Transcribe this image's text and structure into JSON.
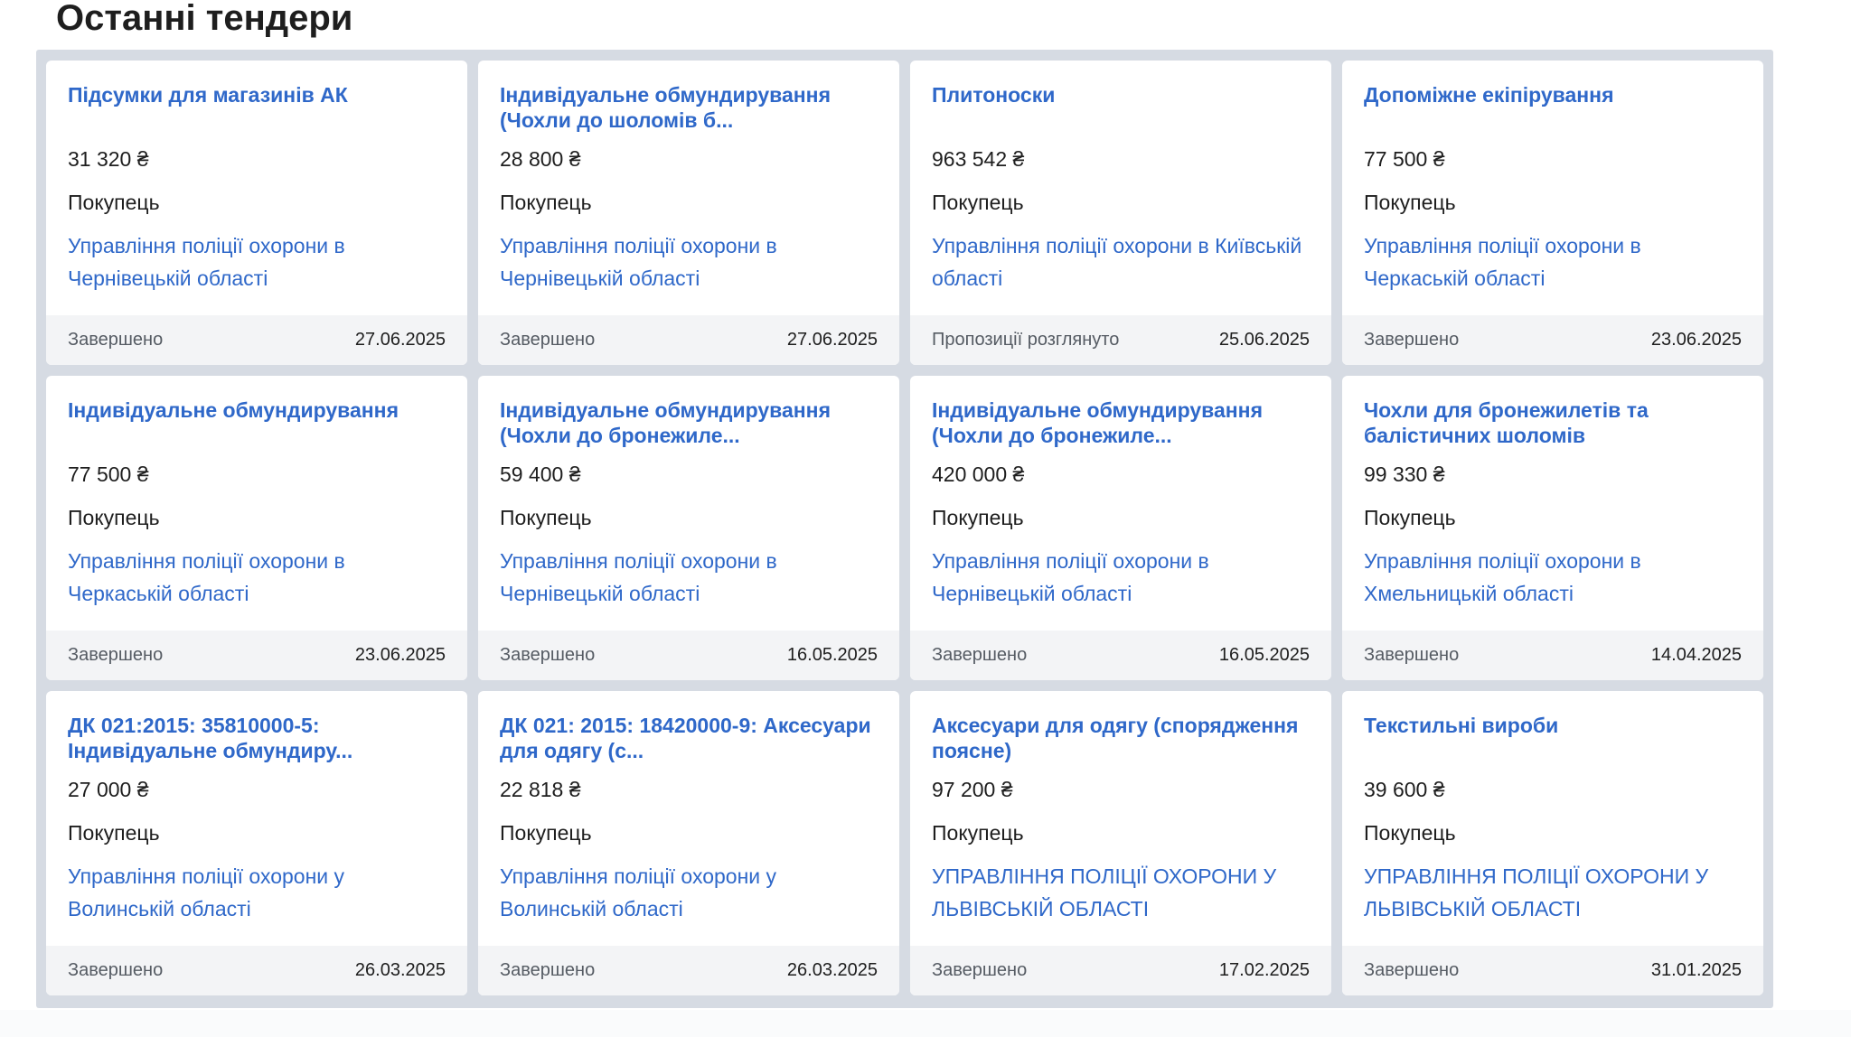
{
  "page_title": "Останні тендери",
  "buyer_label": "Покупець",
  "cards": [
    {
      "title": "Підсумки для магазинів АК",
      "amount": "31 320 ₴",
      "buyer": "Управління поліції охорони в Чернівецькій області",
      "status": "Завершено",
      "date": "27.06.2025"
    },
    {
      "title": "Індивідуальне обмундирування (Чохли до шоломів б...",
      "amount": "28 800 ₴",
      "buyer": "Управління поліції охорони в Чернівецькій області",
      "status": "Завершено",
      "date": "27.06.2025"
    },
    {
      "title": "Плитоноски",
      "amount": "963 542 ₴",
      "buyer": "Управління поліції охорони в Київській області",
      "status": "Пропозиції розглянуто",
      "date": "25.06.2025"
    },
    {
      "title": "Допоміжне екіпірування",
      "amount": "77 500 ₴",
      "buyer": "Управління поліції охорони в Черкаській області",
      "status": "Завершено",
      "date": "23.06.2025"
    },
    {
      "title": "Індивідуальне обмундирування",
      "amount": "77 500 ₴",
      "buyer": "Управління поліції охорони в Черкаській області",
      "status": "Завершено",
      "date": "23.06.2025"
    },
    {
      "title": "Індивідуальне обмундирування (Чохли до бронежиле...",
      "amount": "59 400 ₴",
      "buyer": "Управління поліції охорони в Чернівецькій області",
      "status": "Завершено",
      "date": "16.05.2025"
    },
    {
      "title": "Індивідуальне обмундирування (Чохли до бронежиле...",
      "amount": "420 000 ₴",
      "buyer": "Управління поліції охорони в Чернівецькій області",
      "status": "Завершено",
      "date": "16.05.2025"
    },
    {
      "title": "Чохли для бронежилетів та балістичних шоломів",
      "amount": "99 330 ₴",
      "buyer": "Управління поліції охорони в Хмельницькій області",
      "status": "Завершено",
      "date": "14.04.2025"
    },
    {
      "title": "ДК 021:2015: 35810000-5: Індивідуальне обмундиру...",
      "amount": "27 000 ₴",
      "buyer": "Управління поліції охорони у Волинській області",
      "status": "Завершено",
      "date": "26.03.2025"
    },
    {
      "title": "ДК 021: 2015: 18420000-9: Аксесуари для одягу (с...",
      "amount": "22 818 ₴",
      "buyer": "Управління поліції охорони у Волинській області",
      "status": "Завершено",
      "date": "26.03.2025"
    },
    {
      "title": "Аксесуари для одягу (спорядження поясне)",
      "amount": "97 200 ₴",
      "buyer": "УПРАВЛІННЯ ПОЛІЦІЇ ОХОРОНИ У ЛЬВІВСЬКІЙ ОБЛАСТІ",
      "status": "Завершено",
      "date": "17.02.2025"
    },
    {
      "title": "Текстильні вироби",
      "amount": "39 600 ₴",
      "buyer": "УПРАВЛІННЯ ПОЛІЦІЇ ОХОРОНИ У ЛЬВІВСЬКІЙ ОБЛАСТІ",
      "status": "Завершено",
      "date": "31.01.2025"
    }
  ],
  "colors": {
    "link": "#2f68c9",
    "panel_bg": "#d6dbe3",
    "footer_bg": "#f3f4f6",
    "text": "#1e1e1e",
    "muted": "#555b63"
  }
}
